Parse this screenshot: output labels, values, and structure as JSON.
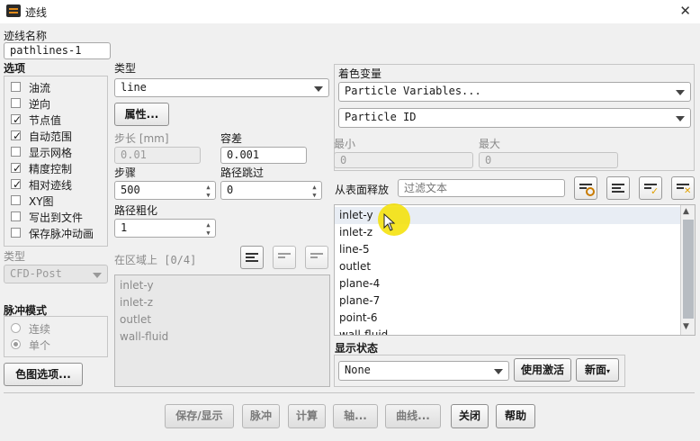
{
  "window": {
    "title": "迹线",
    "close_glyph": "✕"
  },
  "name": {
    "label": "迹线名称",
    "value": "pathlines-1"
  },
  "options": {
    "label": "选项",
    "items": [
      {
        "label": "油流",
        "checked": false
      },
      {
        "label": "逆向",
        "checked": false
      },
      {
        "label": "节点值",
        "checked": true
      },
      {
        "label": "自动范围",
        "checked": true
      },
      {
        "label": "显示网格",
        "checked": false
      },
      {
        "label": "精度控制",
        "checked": true
      },
      {
        "label": "相对迹线",
        "checked": true
      },
      {
        "label": "XY图",
        "checked": false
      },
      {
        "label": "写出到文件",
        "checked": false
      },
      {
        "label": "保存脉冲动画",
        "checked": false
      }
    ],
    "check_glyph": "✓"
  },
  "left_type": {
    "label": "类型",
    "value": "CFD-Post"
  },
  "pulse_mode": {
    "label": "脉冲模式",
    "options": [
      {
        "label": "连续",
        "selected": false
      },
      {
        "label": "单个",
        "selected": true
      }
    ]
  },
  "colormap_button": "色图选项...",
  "style": {
    "type_label": "类型",
    "type_value": "line",
    "attributes_button": "属性...",
    "step_size_label": "步长 [mm]",
    "step_size_value": "0.01",
    "tolerance_label": "容差",
    "tolerance_value": "0.001",
    "steps_label": "步骤",
    "steps_value": "500",
    "path_skip_label": "路径跳过",
    "path_skip_value": "0",
    "coarsen_label": "路径粗化",
    "coarsen_value": "1",
    "spin_up": "▲",
    "spin_down": "▼"
  },
  "zones": {
    "label": "在区域上 [0/4]",
    "items": [
      "inlet-y",
      "inlet-z",
      "outlet",
      "wall-fluid"
    ]
  },
  "color_by": {
    "label": "着色变量",
    "category": "Particle Variables...",
    "variable": "Particle ID",
    "min_label": "最小",
    "min_value": "0",
    "max_label": "最大",
    "max_value": "0"
  },
  "release": {
    "label": "从表面释放",
    "filter_placeholder": "过滤文本",
    "items": [
      "inlet-y",
      "inlet-z",
      "line-5",
      "outlet",
      "plane-4",
      "plane-7",
      "point-6",
      "wall-fluid"
    ],
    "highlighted": "inlet-y",
    "scroll_up": "▲",
    "scroll_down": "▼"
  },
  "display_state": {
    "label": "显示状态",
    "value": "None",
    "use_active": "使用激活",
    "new": "新面"
  },
  "bottom_buttons": [
    {
      "label": "保存/显示",
      "enabled": false
    },
    {
      "label": "脉冲",
      "enabled": false
    },
    {
      "label": "计算",
      "enabled": false
    },
    {
      "label": "轴...",
      "enabled": false
    },
    {
      "label": "曲线...",
      "enabled": false
    },
    {
      "label": "关闭",
      "enabled": true
    },
    {
      "label": "帮助",
      "enabled": true
    }
  ],
  "colors": {
    "highlight": "#e8edf4",
    "cursor_highlight": "#f5e000"
  }
}
